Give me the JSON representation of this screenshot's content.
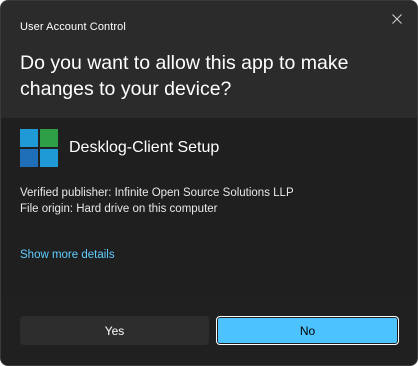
{
  "dialog": {
    "caption": "User Account Control",
    "question": "Do you want to allow this app to make changes to your device?",
    "close_glyph": "×"
  },
  "app": {
    "name": "Desklog-Client Setup",
    "icon": "desklog-app-icon",
    "icon_colors": [
      "#1f9ad6",
      "#1e6fb8",
      "#2e9e47",
      "#1f9ad6"
    ]
  },
  "details": {
    "publisher": "Verified publisher: Infinite Open Source Solutions LLP",
    "origin": "File origin: Hard drive on this computer"
  },
  "link": {
    "show_more": "Show more details"
  },
  "buttons": {
    "yes": "Yes",
    "no": "No"
  },
  "colors": {
    "accent": "#4cc2ff",
    "link": "#60cdff",
    "header_bg": "#2b2b2b",
    "body_bg": "#1f1f1f"
  }
}
